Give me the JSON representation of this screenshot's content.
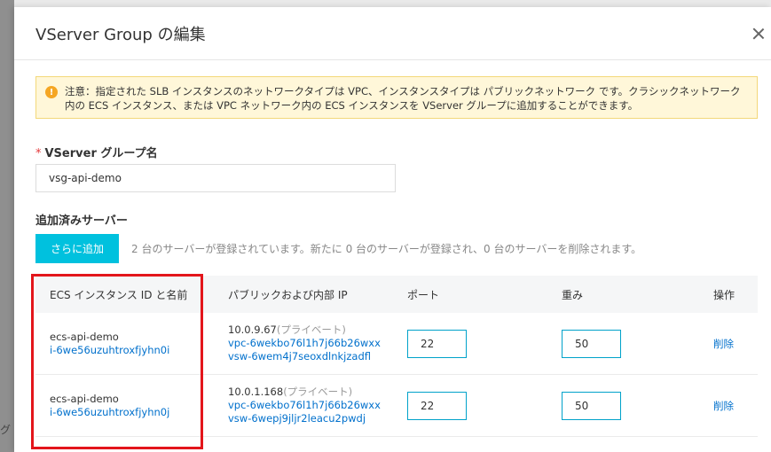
{
  "background": {
    "left_text": "グ"
  },
  "dialog": {
    "title": "VServer Group の編集",
    "notice": "注意：指定された SLB インスタンスのネットワークタイプは VPC、インスタンスタイプは パブリックネットワーク です。クラシックネットワーク内の ECS インスタンス、または VPC ネットワーク内の ECS インスタンスを VServer グループに追加することができます。",
    "group_name_label": "VServer グループ名",
    "group_name_value": "vsg-api-demo",
    "added_servers_label": "追加済みサーバー",
    "add_more_button": "さらに追加",
    "add_info": "2 台のサーバーが登録されています。新たに 0 台のサーバーが登録され、0 台のサーバーを削除されます。",
    "table": {
      "headers": [
        "ECS インスタンス ID と名前",
        "パブリックおよび内部 IP",
        "ポート",
        "重み",
        "操作"
      ],
      "rows": [
        {
          "name": "ecs-api-demo",
          "id": "i-6we56uzuhtroxfjyhn0i",
          "ip": "10.0.9.67",
          "ip_type": "(プライベート)",
          "vpc": "vpc-6wekbo76l1h7j66b26wxx",
          "vsw": "vsw-6wem4j7seoxdlnkjzadfl",
          "port": "22",
          "weight": "50",
          "action": "削除"
        },
        {
          "name": "ecs-api-demo",
          "id": "i-6we56uzuhtroxfjyhn0j",
          "ip": "10.0.1.168",
          "ip_type": "(プライベート)",
          "vpc": "vpc-6wekbo76l1h7j66b26wxx",
          "vsw": "vsw-6wepj9jljr2leacu2pwdj",
          "port": "22",
          "weight": "50",
          "action": "削除"
        }
      ]
    }
  },
  "colors": {
    "accent": "#00c1de",
    "link": "#0070cc",
    "highlight_box": "#e3151b",
    "notice_bg": "#fff7d9"
  }
}
